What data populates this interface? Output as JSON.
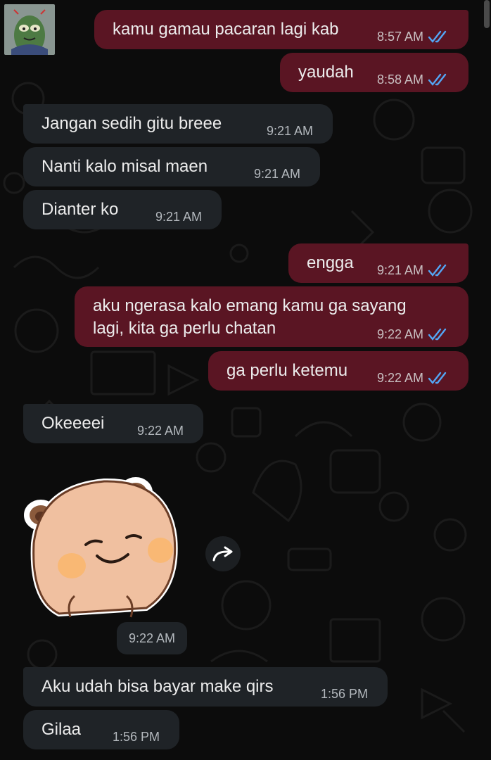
{
  "chat": {
    "messages": [
      {
        "id": "m1",
        "direction": "outgoing",
        "text": "kamu gamau pacaran lagi kab",
        "time": "8:57 AM",
        "status": "read"
      },
      {
        "id": "m2",
        "direction": "outgoing",
        "text": "yaudah",
        "time": "8:58 AM",
        "status": "read"
      },
      {
        "id": "m3",
        "direction": "incoming",
        "text": "Jangan sedih gitu breee",
        "time": "9:21 AM"
      },
      {
        "id": "m4",
        "direction": "incoming",
        "text": "Nanti kalo misal maen",
        "time": "9:21 AM"
      },
      {
        "id": "m5",
        "direction": "incoming",
        "text": "Dianter ko",
        "time": "9:21 AM"
      },
      {
        "id": "m6",
        "direction": "outgoing",
        "text": "engga",
        "time": "9:21 AM",
        "status": "read"
      },
      {
        "id": "m7",
        "direction": "outgoing",
        "text": "aku ngerasa kalo emang kamu ga sayang lagi, kita ga perlu chatan",
        "line1": "aku ngerasa kalo emang kamu ga sayang",
        "line2": "lagi, kita ga perlu chatan",
        "time": "9:22 AM",
        "status": "read"
      },
      {
        "id": "m8",
        "direction": "outgoing",
        "text": "ga perlu ketemu",
        "time": "9:22 AM",
        "status": "read"
      },
      {
        "id": "m9",
        "direction": "incoming",
        "text": "Okeeeei",
        "time": "9:22 AM"
      },
      {
        "id": "m10",
        "direction": "incoming",
        "type": "sticker",
        "sticker": "smiling-bear-sticker",
        "time": "9:22 AM"
      },
      {
        "id": "m11",
        "direction": "incoming",
        "text": "Aku udah bisa bayar make qirs",
        "time": "1:56 PM"
      },
      {
        "id": "m12",
        "direction": "incoming",
        "text": "Gilaa",
        "time": "1:56 PM"
      }
    ]
  },
  "icons": {
    "read_receipt": "double-check-icon",
    "forward": "forward-icon",
    "avatar": "contact-avatar"
  },
  "colors": {
    "outgoing_bubble": "#5a1523",
    "incoming_bubble": "#1f2327",
    "read_tick": "#53a6f5",
    "background": "#0c0c0c"
  }
}
